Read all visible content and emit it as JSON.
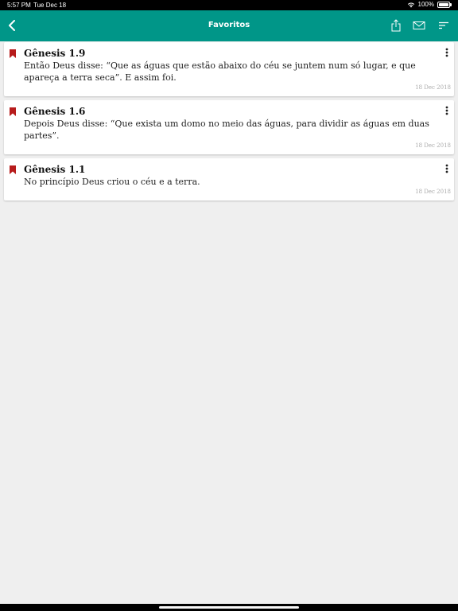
{
  "status_bar": {
    "time": "5:57 PM",
    "date": "Tue Dec 18",
    "battery": "100%",
    "battery_level": 1.0
  },
  "nav": {
    "title": "Favoritos",
    "back_icon": "chevron-left-icon",
    "actions": [
      "share-icon",
      "mail-icon",
      "sort-icon"
    ]
  },
  "colors": {
    "primary": "#009688",
    "bookmark": "#b71c1c",
    "background": "#efefef"
  },
  "favorites": [
    {
      "ref": "Gênesis 1.9",
      "text": "Então Deus disse: “Que as águas que estão abaixo do céu se juntem num só lugar, e que apareça a terra seca”. E assim foi.",
      "date": "18 Dec 2018"
    },
    {
      "ref": "Gênesis 1.6",
      "text": "Depois Deus disse: “Que exista um domo no meio das águas, para dividir as águas em duas partes”.",
      "date": "18 Dec 2018"
    },
    {
      "ref": "Gênesis 1.1",
      "text": "No princípio Deus criou o céu e a terra.",
      "date": "18 Dec 2018"
    }
  ]
}
